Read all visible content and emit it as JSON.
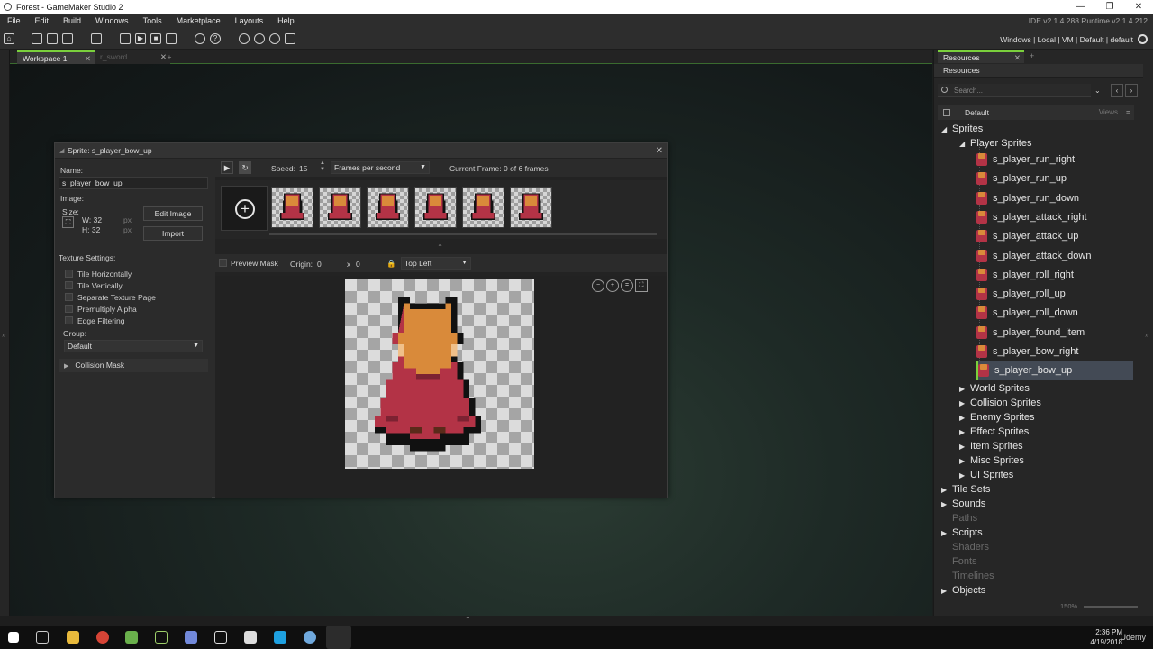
{
  "window": {
    "title": "Forest - GameMaker Studio 2",
    "controls": [
      "—",
      "❐",
      "✕"
    ]
  },
  "menu": {
    "items": [
      "File",
      "Edit",
      "Build",
      "Windows",
      "Tools",
      "Marketplace",
      "Layouts",
      "Help"
    ],
    "version": "IDE v2.1.4.288 Runtime v2.1.4.212"
  },
  "toolbar": {
    "target": "Windows | Local | VM | Default | default"
  },
  "workspace": {
    "tabs": [
      {
        "label": "Workspace 1",
        "active": true
      },
      {
        "label": "r_sword",
        "active": false
      }
    ],
    "add_tab": "+"
  },
  "sprite_editor": {
    "title": "Sprite: s_player_bow_up",
    "name_label": "Name:",
    "name_value": "s_player_bow_up",
    "image_label": "Image:",
    "size_label": "Size:",
    "width": "W: 32",
    "height": "H: 32",
    "unit": "px",
    "edit_image": "Edit Image",
    "import": "Import",
    "texture_label": "Texture Settings:",
    "texture_options": [
      "Tile Horizontally",
      "Tile Vertically",
      "Separate Texture Page",
      "Premultiply Alpha",
      "Edge Filtering"
    ],
    "group_label": "Group:",
    "group_value": "Default",
    "collision_mask": "Collision Mask",
    "speed_label": "Speed:",
    "speed_value": "15",
    "speed_unit": "Frames per second",
    "current_frame": "Current Frame: 0 of 6 frames",
    "frame_count": 6,
    "preview_mask": "Preview Mask",
    "origin_label": "Origin:",
    "origin_x": "0",
    "origin_sep": "x",
    "origin_y": "0",
    "origin_preset": "Top Left"
  },
  "resources": {
    "tab": "Resources",
    "header": "Resources",
    "search_placeholder": "Search...",
    "default_label": "Default",
    "views": "Views",
    "sprites": "Sprites",
    "player_sprites": "Player Sprites",
    "player_items": [
      "s_player_run_right",
      "s_player_run_up",
      "s_player_run_down",
      "s_player_attack_right",
      "s_player_attack_up",
      "s_player_attack_down",
      "s_player_roll_right",
      "s_player_roll_up",
      "s_player_roll_down",
      "s_player_found_item",
      "s_player_bow_right",
      "s_player_bow_up"
    ],
    "selected": "s_player_bow_up",
    "sprite_groups": [
      "World Sprites",
      "Collision Sprites",
      "Enemy Sprites",
      "Effect Sprites",
      "Item Sprites",
      "Misc Sprites",
      "UI Sprites"
    ],
    "top_level": [
      {
        "label": "Tile Sets",
        "enabled": true
      },
      {
        "label": "Sounds",
        "enabled": true
      },
      {
        "label": "Paths",
        "enabled": false
      },
      {
        "label": "Scripts",
        "enabled": true
      },
      {
        "label": "Shaders",
        "enabled": false
      },
      {
        "label": "Fonts",
        "enabled": false
      },
      {
        "label": "Timelines",
        "enabled": false
      },
      {
        "label": "Objects",
        "enabled": true
      }
    ],
    "zoom": "150%"
  },
  "taskbar": {
    "time": "2:36 PM",
    "date": "4/19/2018",
    "watermark": "Udemy"
  },
  "colors": {
    "accent": "#7ad03c",
    "selection": "#434a55",
    "robe": "#b33346",
    "skin": "#d98a3a"
  }
}
